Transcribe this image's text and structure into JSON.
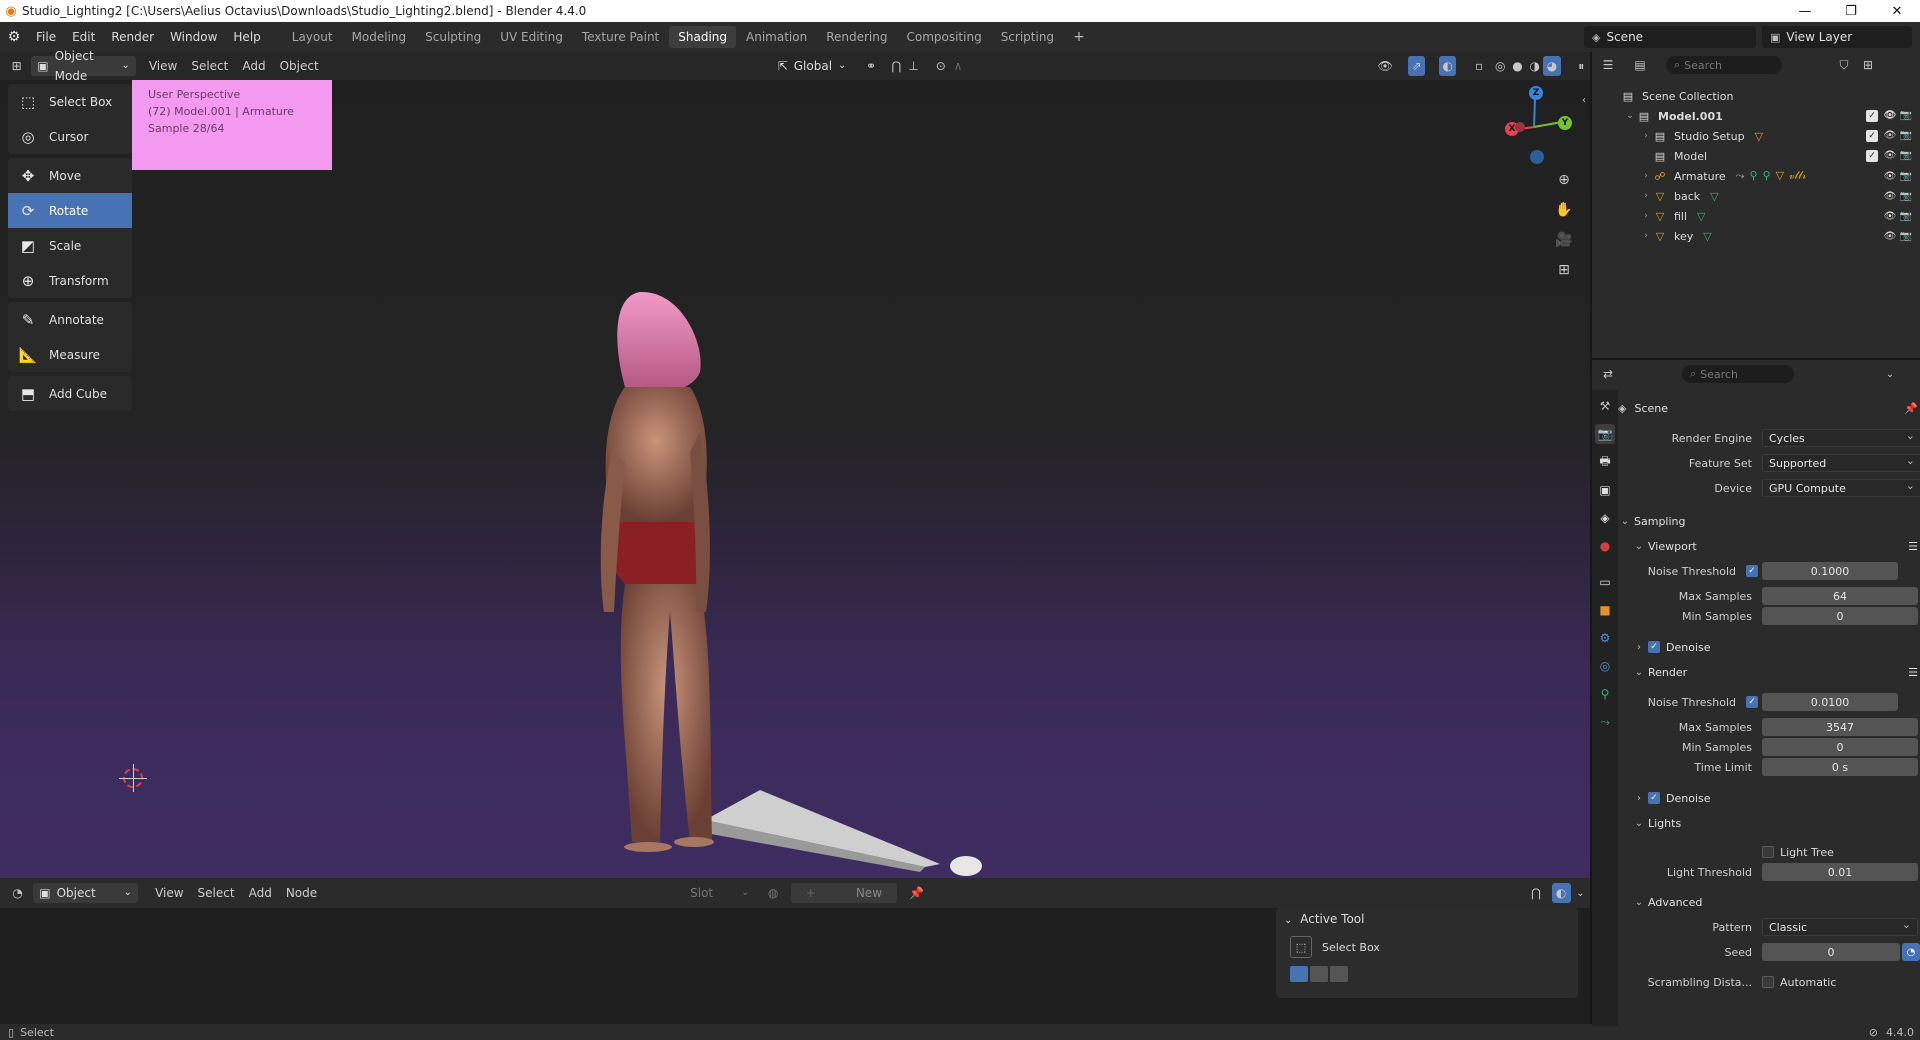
{
  "window": {
    "title": "Studio_Lighting2 [C:\\Users\\Aelius Octavius\\Downloads\\Studio_Lighting2.blend] - Blender 4.4.0",
    "controls": [
      "—",
      "❐",
      "✕"
    ]
  },
  "menu": [
    "File",
    "Edit",
    "Render",
    "Window",
    "Help"
  ],
  "workspaces": [
    {
      "label": "Layout",
      "active": false
    },
    {
      "label": "Modeling",
      "active": false
    },
    {
      "label": "Sculpting",
      "active": false
    },
    {
      "label": "UV Editing",
      "active": false
    },
    {
      "label": "Texture Paint",
      "active": false
    },
    {
      "label": "Shading",
      "active": true
    },
    {
      "label": "Animation",
      "active": false
    },
    {
      "label": "Rendering",
      "active": false
    },
    {
      "label": "Compositing",
      "active": false
    },
    {
      "label": "Scripting",
      "active": false
    }
  ],
  "scene_selector": "Scene",
  "view_layer": "View Layer",
  "viewport": {
    "mode": "Object Mode",
    "menus": [
      "View",
      "Select",
      "Add",
      "Object"
    ],
    "transform_orientation": "Global",
    "overlay_info": [
      "User Perspective",
      "(72) Model.001 | Armature",
      "Sample 28/64"
    ],
    "tools": [
      {
        "label": "Select Box",
        "icon": "select-box-icon",
        "glyph": "⬚",
        "active": false,
        "group": 0
      },
      {
        "label": "Cursor",
        "icon": "cursor-icon",
        "glyph": "◎",
        "active": false,
        "group": 0
      },
      {
        "label": "Move",
        "icon": "move-icon",
        "glyph": "✥",
        "active": false,
        "group": 1
      },
      {
        "label": "Rotate",
        "icon": "rotate-icon",
        "glyph": "⟳",
        "active": true,
        "group": 1
      },
      {
        "label": "Scale",
        "icon": "scale-icon",
        "glyph": "◩",
        "active": false,
        "group": 1
      },
      {
        "label": "Transform",
        "icon": "transform-icon",
        "glyph": "⊕",
        "active": false,
        "group": 1
      },
      {
        "label": "Annotate",
        "icon": "annotate-icon",
        "glyph": "✎",
        "active": false,
        "group": 2
      },
      {
        "label": "Measure",
        "icon": "measure-icon",
        "glyph": "📐",
        "active": false,
        "group": 2
      },
      {
        "label": "Add Cube",
        "icon": "add-cube-icon",
        "glyph": "⬒",
        "active": false,
        "group": 3
      }
    ],
    "gizmo_axes": {
      "x": "X",
      "y": "Y",
      "z": "Z"
    },
    "colors": {
      "x_axis": "#e8414f",
      "y_axis": "#74c22f",
      "z_axis": "#3a82dc"
    }
  },
  "node_editor": {
    "type": "Object",
    "menus": [
      "View",
      "Select",
      "Add",
      "Node"
    ],
    "slot": "Slot",
    "new_button": "New",
    "active_tool_title": "Active Tool",
    "active_tool_name": "Select Box"
  },
  "status_bar": {
    "left": "Select",
    "version": "4.4.0"
  },
  "outliner": {
    "search_placeholder": "Search",
    "rows": [
      {
        "label": "Scene Collection",
        "indent": 0,
        "icon": "scene-collection-icon",
        "glyph": "▤",
        "arrow": "",
        "checkbox": false,
        "eye": false,
        "cam": false,
        "mods": []
      },
      {
        "label": "Model.001",
        "indent": 1,
        "icon": "collection-icon",
        "glyph": "▤",
        "arrow": "⌄",
        "checkbox": true,
        "eye": true,
        "cam": true,
        "mods": []
      },
      {
        "label": "Studio Setup",
        "indent": 2,
        "icon": "collection-icon",
        "glyph": "▤",
        "arrow": "›",
        "checkbox": true,
        "eye": true,
        "cam": true,
        "mods": [
          {
            "g": "▽",
            "c": "o"
          }
        ]
      },
      {
        "label": "Model",
        "indent": 2,
        "icon": "collection-icon",
        "glyph": "▤",
        "arrow": "",
        "checkbox": true,
        "eye": true,
        "cam": true,
        "mods": []
      },
      {
        "label": "Armature",
        "indent": 2,
        "icon": "armature-icon",
        "glyph": "☍",
        "arrow": "›",
        "checkbox": false,
        "eye": true,
        "cam": true,
        "mods": [
          {
            "g": "⤳",
            "c": "w"
          },
          {
            "g": "⚲",
            "c": "g"
          },
          {
            "g": "⚲",
            "c": "g"
          },
          {
            "g": "▽",
            "c": "o"
          },
          {
            "g": "𝓋𝓁𝓁𝓇",
            "c": "o"
          }
        ]
      },
      {
        "label": "back",
        "indent": 2,
        "icon": "mesh-icon",
        "glyph": "▽",
        "arrow": "›",
        "checkbox": false,
        "eye": true,
        "cam": true,
        "mods": [
          {
            "g": "▽",
            "c": "g"
          }
        ]
      },
      {
        "label": "fill",
        "indent": 2,
        "icon": "mesh-icon",
        "glyph": "▽",
        "arrow": "›",
        "checkbox": false,
        "eye": true,
        "cam": true,
        "mods": [
          {
            "g": "▽",
            "c": "g"
          }
        ]
      },
      {
        "label": "key",
        "indent": 2,
        "icon": "mesh-icon",
        "glyph": "▽",
        "arrow": "›",
        "checkbox": false,
        "eye": true,
        "cam": true,
        "mods": [
          {
            "g": "▽",
            "c": "g"
          }
        ]
      }
    ]
  },
  "properties": {
    "search_placeholder": "Search",
    "context": "Scene",
    "render_engine_label": "Render Engine",
    "render_engine": "Cycles",
    "feature_set_label": "Feature Set",
    "feature_set": "Supported",
    "device_label": "Device",
    "device": "GPU Compute",
    "sampling": "Sampling",
    "viewport": "Viewport",
    "noise_threshold_label": "Noise Threshold",
    "vp_noise_threshold": "0.1000",
    "max_samples_label": "Max Samples",
    "vp_max_samples": "64",
    "min_samples_label": "Min Samples",
    "vp_min_samples": "0",
    "denoise_label": "Denoise",
    "render": "Render",
    "r_noise_threshold": "0.0100",
    "r_max_samples": "3547",
    "r_min_samples": "0",
    "time_limit_label": "Time Limit",
    "time_limit": "0 s",
    "lights": "Lights",
    "light_tree_label": "Light Tree",
    "light_threshold_label": "Light Threshold",
    "light_threshold": "0.01",
    "advanced": "Advanced",
    "pattern_label": "Pattern",
    "pattern": "Classic",
    "seed_label": "Seed",
    "seed": "0",
    "scrambling_label": "Scrambling Dista...",
    "automatic_label": "Automatic"
  }
}
